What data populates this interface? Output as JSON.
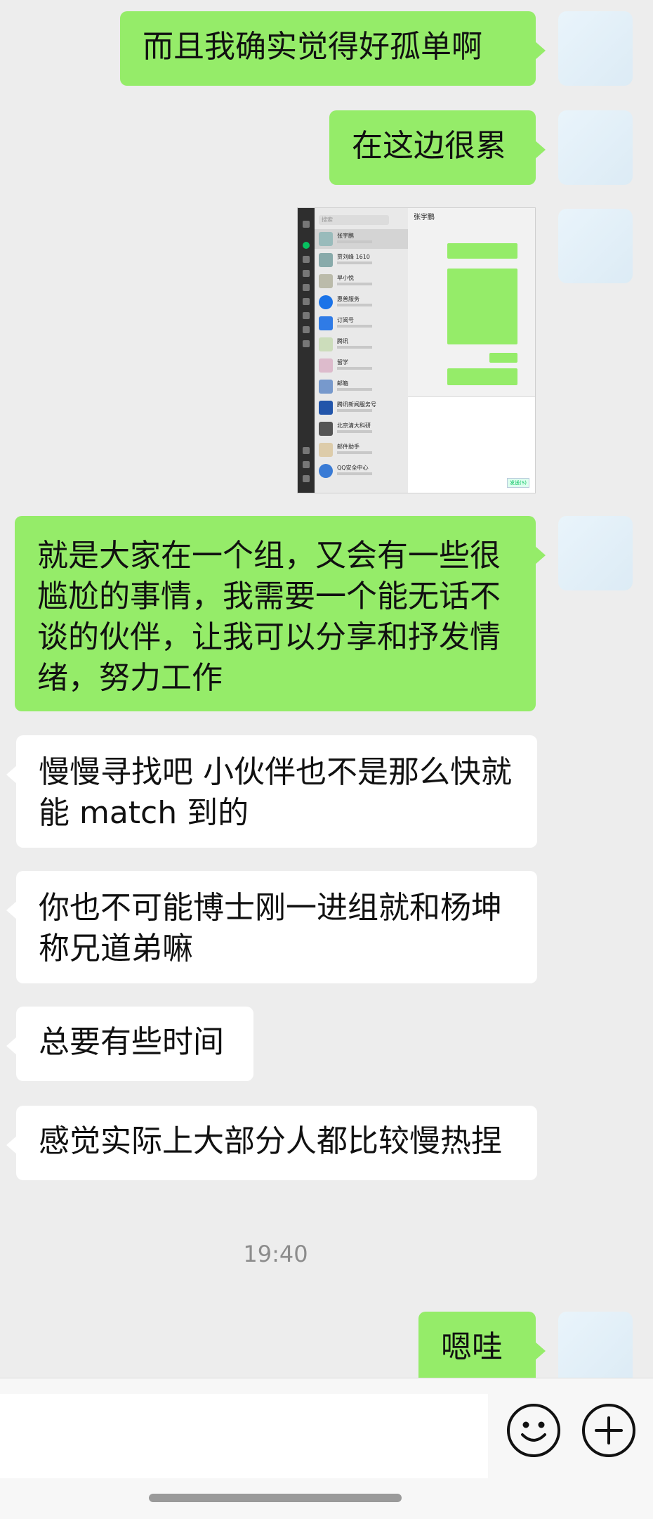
{
  "messages": [
    {
      "sender": "me",
      "text": "而且我确实觉得好孤单啊"
    },
    {
      "sender": "me",
      "text": "在这边很累"
    },
    {
      "sender": "me",
      "type": "image"
    },
    {
      "sender": "me",
      "text": "就是大家在一个组，又会有一些很尴尬的事情，我需要一个能无话不谈的伙伴，让我可以分享和抒发情绪，努力工作"
    },
    {
      "sender": "other",
      "text": "慢慢寻找吧 小伙伴也不是那么快就能 match 到的"
    },
    {
      "sender": "other",
      "text": "你也不可能博士刚一进组就和杨坤称兄道弟嘛"
    },
    {
      "sender": "other",
      "text": "总要有些时间"
    },
    {
      "sender": "other",
      "text": "感觉实际上大部分人都比较慢热捏"
    },
    {
      "sender": "me",
      "text": "嗯哇"
    }
  ],
  "timestamp": "19:40",
  "embedded_screenshot": {
    "search_placeholder": "搜索",
    "chat_title": "张宇鹏",
    "send_label": "发送(S)",
    "contacts": [
      "张宇鹏",
      "贾刘峰 1610",
      "早小悦",
      "惠普服务",
      "订阅号",
      "腾讯",
      "留学",
      "邮箱",
      "腾讯新闻服务号",
      "北京清大科研",
      "邮件助手",
      "QQ安全中心"
    ]
  },
  "input_bar": {
    "emoji_icon": "smiley-icon",
    "plus_icon": "plus-circle-icon"
  }
}
